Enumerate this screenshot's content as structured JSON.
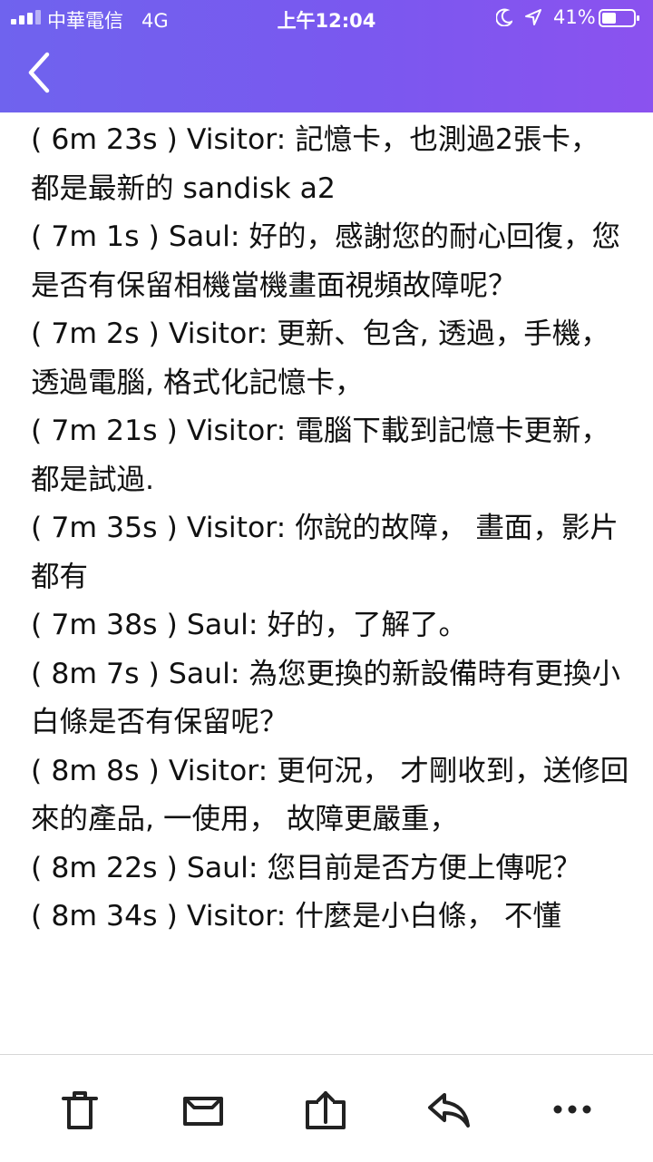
{
  "status_bar": {
    "carrier": "中華電信",
    "network": "4G",
    "time": "上午12:04",
    "battery": "41%"
  },
  "header": {
    "back_icon": "chevron-left-icon"
  },
  "messages": [
    {
      "time": "6m 23s",
      "speaker": "Visitor",
      "text": "記憶卡，也測過2張卡， 都是最新的 sandisk a2"
    },
    {
      "time": "7m 1s",
      "speaker": "Saul",
      "text": "好的，感謝您的耐心回復，您是否有保留相機當機畫面視頻故障呢？"
    },
    {
      "time": "7m 2s",
      "speaker": "Visitor",
      "text": "更新、包含, 透過，手機， 透過電腦, 格式化記憶卡，"
    },
    {
      "time": "7m 21s",
      "speaker": "Visitor",
      "text": "電腦下載到記憶卡更新， 都是試過."
    },
    {
      "time": "7m 35s",
      "speaker": "Visitor",
      "text": "你說的故障， 畫面，影片都有"
    },
    {
      "time": "7m 38s",
      "speaker": "Saul",
      "text": "好的，了解了。"
    },
    {
      "time": "8m 7s",
      "speaker": "Saul",
      "text": "為您更換的新設備時有更換小白條是否有保留呢？"
    },
    {
      "time": "8m 8s",
      "speaker": "Visitor",
      "text": "更何況， 才剛收到，送修回來的產品, 一使用， 故障更嚴重，"
    },
    {
      "time": "8m 22s",
      "speaker": "Saul",
      "text": "您目前是否方便上傳呢？"
    },
    {
      "time": "8m 34s",
      "speaker": "Visitor",
      "text": "什麼是小白條， 不懂"
    }
  ],
  "toolbar": {
    "icons": [
      "trash-icon",
      "archive-icon",
      "move-to-folder-icon",
      "reply-icon",
      "more-icon"
    ]
  },
  "colors": {
    "header_start": "#6f63ee",
    "header_end": "#8b52ef",
    "icon": "#222222",
    "text": "#111111"
  }
}
